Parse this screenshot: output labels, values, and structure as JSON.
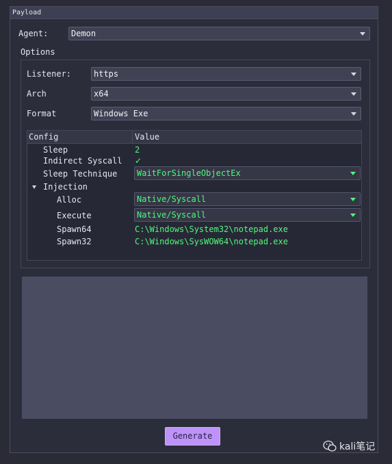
{
  "window": {
    "title": "Payload"
  },
  "agent": {
    "label": "Agent:",
    "value": "Demon"
  },
  "options": {
    "title": "Options",
    "listener": {
      "label": "Listener:",
      "value": "https"
    },
    "arch": {
      "label": "Arch",
      "value": "x64"
    },
    "format": {
      "label": "Format",
      "value": "Windows Exe"
    }
  },
  "config_table": {
    "headers": [
      "Config",
      "Value"
    ],
    "sleep": {
      "label": "Sleep",
      "value": "2"
    },
    "indirect_syscall": {
      "label": "Indirect Syscall",
      "value": "✓"
    },
    "sleep_technique": {
      "label": "Sleep Technique",
      "value": "WaitForSingleObjectEx"
    },
    "injection": {
      "label": "Injection",
      "alloc": {
        "label": "Alloc",
        "value": "Native/Syscall"
      },
      "execute": {
        "label": "Execute",
        "value": "Native/Syscall"
      },
      "spawn64": {
        "label": "Spawn64",
        "value": "C:\\Windows\\System32\\notepad.exe"
      },
      "spawn32": {
        "label": "Spawn32",
        "value": "C:\\Windows\\SysWOW64\\notepad.exe"
      }
    }
  },
  "generate_button": {
    "label": "Generate"
  },
  "watermark": {
    "text": "kali笔记"
  },
  "colors": {
    "accent": "#bd93f9",
    "value_green": "#50fa7b",
    "background": "#2c2d3b"
  }
}
